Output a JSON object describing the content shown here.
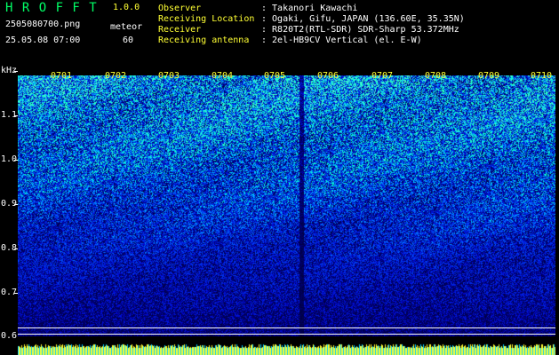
{
  "header": {
    "app_title": "H R O F F T",
    "version": "1.0.0",
    "filename": "2505080700.png",
    "datetime": "25.05.08 07:00",
    "meteor_label": "meteor",
    "meteor_count": "60"
  },
  "info": [
    {
      "label": "Observer",
      "value": ": Takanori Kawachi"
    },
    {
      "label": "Receiving Location",
      "value": ": Ogaki, Gifu, JAPAN (136.60E, 35.35N)"
    },
    {
      "label": "Receiver",
      "value": ": R820T2(RTL-SDR) SDR-Sharp 53.372MHz"
    },
    {
      "label": "Receiving antenna",
      "value": ": 2el-HB9CV Vertical (el. E-W)"
    }
  ],
  "colors": {
    "title": "#00ff66",
    "label": "#ffff33",
    "text": "#ffffff",
    "background": "#000000",
    "bottom_bar": "#00ccff"
  },
  "spectrum": {
    "y_unit": "kHz",
    "y_ticks": [
      "1.1",
      "1.0",
      "0.9",
      "0.8",
      "0.7",
      "0.6"
    ],
    "y_range_khz": [
      0.6,
      1.2
    ],
    "x_ticks": [
      "0701",
      "0702",
      "0703",
      "0704",
      "0705",
      "0706",
      "0707",
      "0708",
      "0709",
      "0710"
    ],
    "vertical_streak_minute": "0705.5"
  }
}
